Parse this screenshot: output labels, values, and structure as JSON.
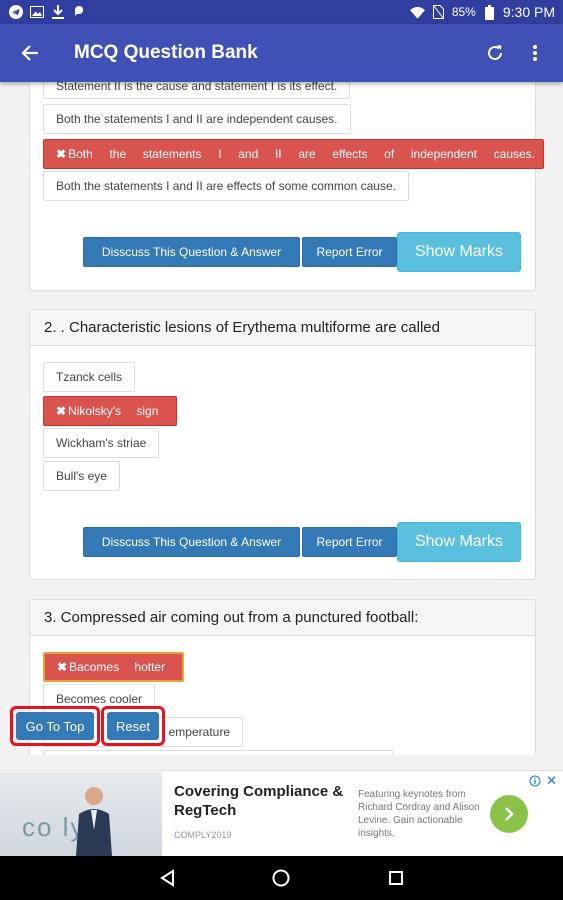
{
  "status_bar": {
    "battery": "85%",
    "time": "9:30 PM"
  },
  "app_bar": {
    "title": "MCQ Question Bank"
  },
  "question1": {
    "options": [
      "Statement II is the cause and statement I is its effect.",
      "Both the statements I and II are independent causes.",
      "Both the statements I and II are effects of independent causes.",
      "Both the statements I and II are effects of some common cause."
    ],
    "wrong_mark": "✖",
    "discuss_label": "Disscuss This Question & Answer",
    "report_label": "Report Error",
    "marks_label": "Show Marks"
  },
  "question2": {
    "title": "2. . Characteristic lesions of Erythema multiforme are called",
    "options": [
      "Tzanck cells",
      "Nikolsky's sign",
      "Wickham's striae",
      "Bull's eye"
    ],
    "wrong_mark": "✖",
    "discuss_label": "Disscuss This Question & Answer",
    "report_label": "Report Error",
    "marks_label": "Show Marks"
  },
  "question3": {
    "title": "3. Compressed air coming out from a punctured football:",
    "options": [
      "Bacomes hotter",
      "Becomes cooler",
      "emperature"
    ],
    "wrong_mark": "✖"
  },
  "floating": {
    "go_top_label": "Go To Top",
    "reset_label": "Reset"
  },
  "ad": {
    "brand": "co ly",
    "title": "Covering Compliance & RegTech",
    "sub": "COMPLY2019",
    "desc": "Featuring keynotes from Richard Cordray and Alison Levine. Gain actionable insights."
  },
  "colors": {
    "app_bar": "#3f51b5",
    "status_bar": "#303f9f",
    "primary_button": "#337ab7",
    "info_button": "#5bc0de",
    "wrong_answer": "#d9534f",
    "highlight_border": "#e8121e"
  },
  "icons": {
    "status_left": [
      "telegram-icon",
      "image-icon",
      "download-icon",
      "app-notification-icon"
    ],
    "status_right": [
      "wifi-icon",
      "no-sim-icon",
      "battery-icon"
    ],
    "app_bar": [
      "back-arrow-icon",
      "refresh-icon",
      "more-vert-icon"
    ],
    "nav": [
      "back-triangle-icon",
      "home-circle-icon",
      "recents-square-icon"
    ]
  }
}
